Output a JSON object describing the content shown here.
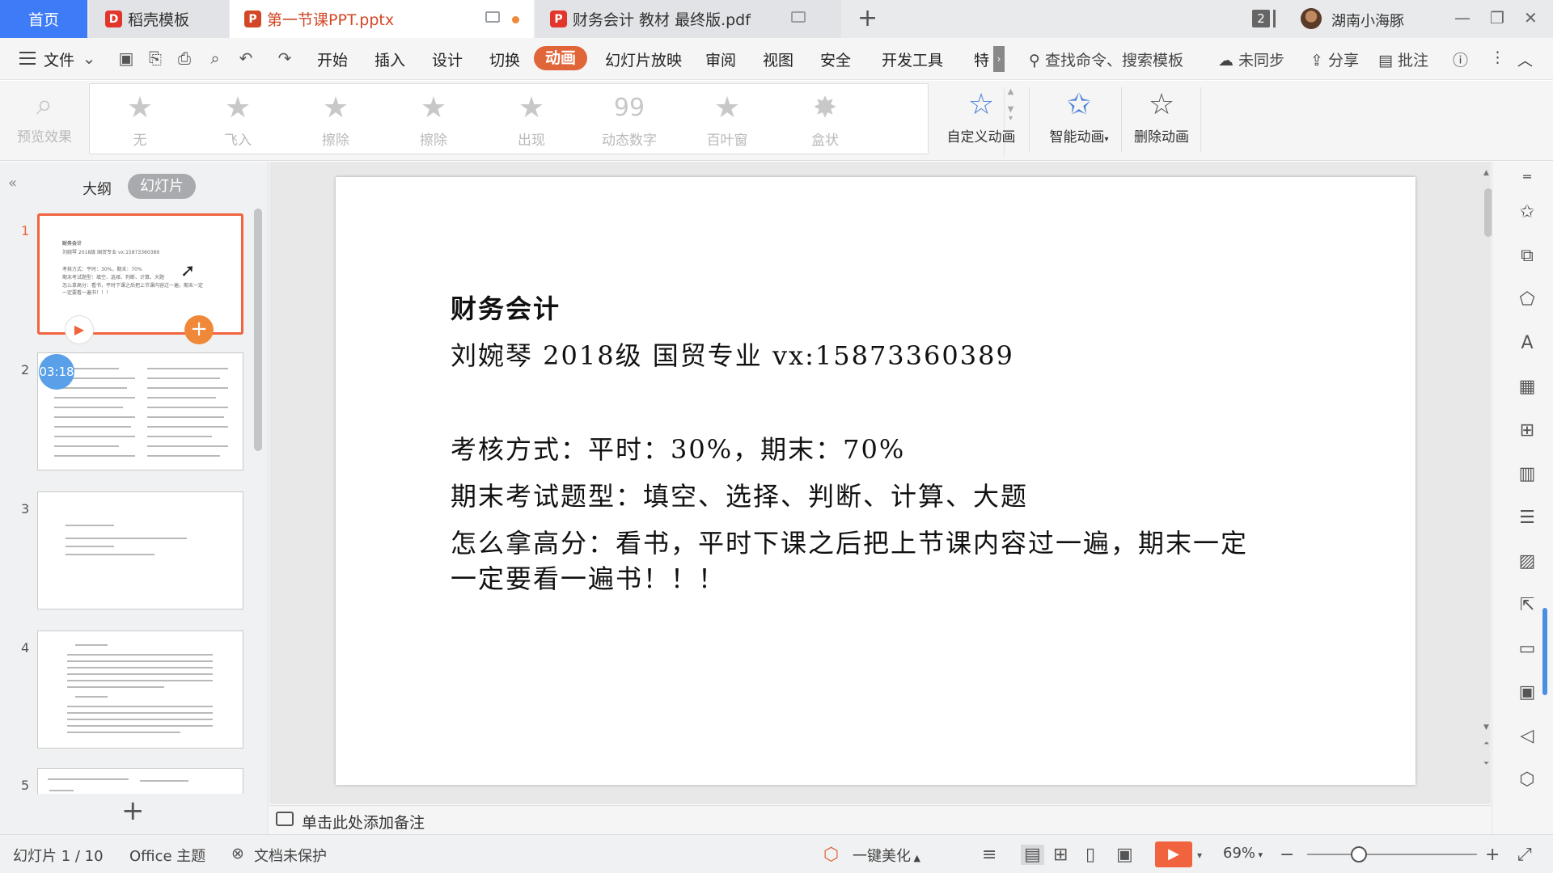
{
  "tabs": {
    "home": "首页",
    "daoke": "稻壳模板",
    "ppt": "第一节课PPT.pptx",
    "pdf": "财务会计 教材 最终版.pdf",
    "window_count": "2",
    "user_name": "湖南小海豚"
  },
  "menu": {
    "file": "文件",
    "items": [
      "开始",
      "插入",
      "设计",
      "切换",
      "动画",
      "幻灯片放映",
      "审阅",
      "视图",
      "安全",
      "开发工具",
      "特"
    ],
    "search": "查找命令、搜索模板",
    "sync": "未同步",
    "share": "分享",
    "comment": "批注"
  },
  "ribbon": {
    "preview": "预览效果",
    "effects": [
      "无",
      "飞入",
      "擦除",
      "擦除",
      "出现",
      "动态数字",
      "百叶窗",
      "盒状"
    ],
    "custom": "自定义动画",
    "smart": "智能动画",
    "delete": "删除动画"
  },
  "leftpanel": {
    "outline": "大纲",
    "slides": "幻灯片",
    "timer": "03:18",
    "nums": [
      "1",
      "2",
      "3",
      "4",
      "5"
    ],
    "thumb1": [
      "财务会计",
      "刘婉琴 2018级 国贸专业 vx:15873360389",
      "考核方式：平时：30%，期末：70%",
      "期末考试题型：填空、选择、判断、计算、大题",
      "怎么拿高分：看书，平时下课之后把上节课内容过一遍，期末一定",
      "一定要看一遍书！！！"
    ]
  },
  "slide": {
    "title": "财务会计",
    "line1": "刘婉琴 2018级 国贸专业 vx:15873360389",
    "line2": "考核方式：平时：30%，期末：70%",
    "line3": "期末考试题型：填空、选择、判断、计算、大题",
    "line4": "怎么拿高分：看书，平时下课之后把上节课内容过一遍，期末一定",
    "line5": "一定要看一遍书！！！"
  },
  "notes": {
    "placeholder": "单击此处添加备注"
  },
  "status": {
    "slide_count": "幻灯片 1 / 10",
    "theme": "Office 主题",
    "protect": "文档未保护",
    "beautify": "一键美化",
    "zoom": "69%"
  },
  "colors": {
    "accent": "#e0663a",
    "home_tab": "#3e7bf6",
    "play": "#f0633e"
  }
}
